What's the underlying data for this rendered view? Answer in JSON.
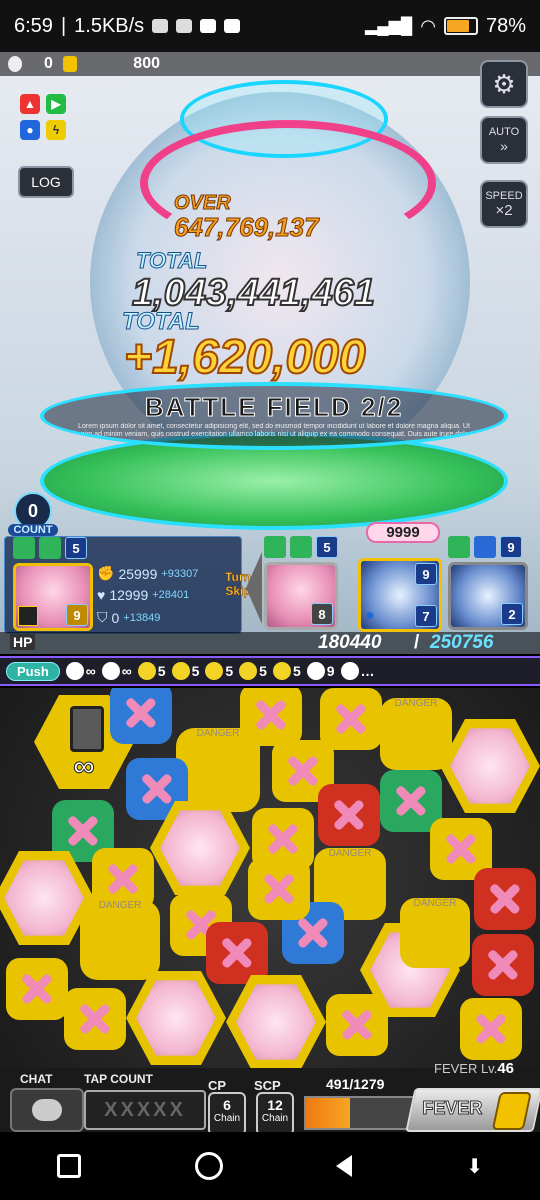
{
  "status_bar": {
    "time": "6:59",
    "net_speed": "1.5KB/s",
    "battery": "78%"
  },
  "top_bar": {
    "egg_count": "0",
    "coin_count": "800"
  },
  "side_buttons": {
    "log": "LOG",
    "auto": "AUTO",
    "speed_label": "SPEED",
    "speed_value": "×2"
  },
  "damage": {
    "over_label": "OVER",
    "over_value": "647,769,137",
    "total_label": "TOTAL",
    "total_value": "1,043,441,461",
    "total2_label": "TOTAL",
    "total2_value": "+1,620,000"
  },
  "battle_field": {
    "label": "BATTLE FIELD 2/2",
    "lore": "Lorem ipsum dolor sit amet, consectetur adipisicing elit, sed do eiusmod tempor incididunt ut labore et dolore magna aliqua. Ut enim ad minim veniam, quis nostrud exercitation ullamco laboris nisi ut aliquip ex ea commodo consequat. Duis aute irure dolor in reprehenderit in voluptate velit esse cillum"
  },
  "count": {
    "value": "0",
    "label": "COUNT"
  },
  "player_card": {
    "skill_num": "5",
    "level": "9",
    "attack": "25999",
    "attack_bonus": "+93307",
    "hp": "12999",
    "hp_bonus": "+28401",
    "defense": "0",
    "defense_bonus": "+13849"
  },
  "turn_skip": {
    "line1": "Turn",
    "line2": "Skip"
  },
  "enemies": [
    {
      "top_num": "5",
      "bottom_num": "8",
      "hp_label": ""
    },
    {
      "top_label": "9999",
      "badge": "9",
      "bottom_num": "7"
    },
    {
      "badge": "9",
      "bottom_num": "2"
    }
  ],
  "hp": {
    "label": "HP",
    "current": "180440",
    "max": "250756"
  },
  "skill_bar": {
    "push_label": "Push",
    "items": [
      {
        "icon": "dp-icon",
        "value": "∞"
      },
      {
        "icon": "skull-icon",
        "value": "∞"
      },
      {
        "icon": "sun-icon",
        "value": "5"
      },
      {
        "icon": "flame-icon",
        "value": "5"
      },
      {
        "icon": "club-icon",
        "value": "5"
      },
      {
        "icon": "bolt-icon",
        "value": "5"
      },
      {
        "icon": "spade-icon",
        "value": "5"
      },
      {
        "icon": "flame-white-icon",
        "value": "9"
      },
      {
        "icon": "club-white-icon",
        "value": "…"
      }
    ]
  },
  "puzzle": {
    "danger_label": "DANGER",
    "infinity": "∞"
  },
  "hud": {
    "chat_label": "CHAT",
    "tap_count_label": "TAP COUNT",
    "tap_count_value": "XXXXX",
    "cp_label": "CP",
    "cp_value": "6",
    "cp_unit": "Chain",
    "scp_label": "SCP",
    "scp_value": "12",
    "scp_unit": "Chain",
    "fever_progress": "491/1279",
    "fever_level_label": "FEVER Lv.",
    "fever_level_value": "46",
    "fever_button": "FEVER",
    "fever_fill_fraction": 0.38
  },
  "colors": {
    "gold": "#f2c200",
    "fever_orange": "#f59a1a",
    "skill_border": "#8a5cff",
    "hp_max": "#6ee0ff"
  }
}
